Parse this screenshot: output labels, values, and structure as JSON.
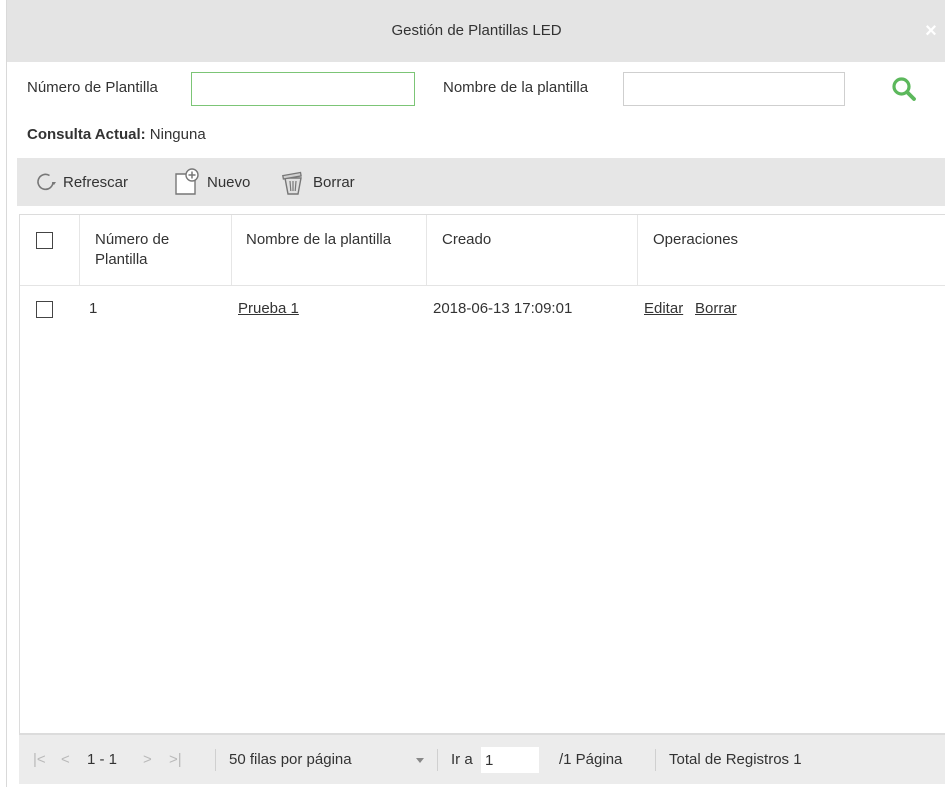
{
  "dialog": {
    "title": "Gestión de Plantillas LED",
    "close_glyph": "×"
  },
  "search": {
    "number_label": "Número de Plantilla",
    "number_value": "",
    "name_label": "Nombre de la plantilla",
    "name_value": "",
    "search_icon": "search-icon"
  },
  "query": {
    "label": "Consulta Actual:",
    "value": "Ninguna"
  },
  "toolbar": {
    "refresh_label": "Refrescar",
    "new_label": "Nuevo",
    "delete_label": "Borrar"
  },
  "table": {
    "headers": {
      "number": "Número de Plantilla",
      "name": "Nombre de la plantilla",
      "created": "Creado",
      "operations": "Operaciones"
    },
    "rows": [
      {
        "number": "1",
        "name": "Prueba 1",
        "created": "2018-06-13 17:09:01",
        "edit": "Editar",
        "delete": "Borrar"
      }
    ]
  },
  "pager": {
    "first": "|<",
    "prev": "<",
    "range": "1 - 1",
    "next": ">",
    "last": ">|",
    "rows_per_page": "50 filas por página",
    "goto_label": "Ir a",
    "goto_value": "1",
    "pages": "/1 Página",
    "total": "Total de Registros 1"
  },
  "colors": {
    "title_bar": "#e4e4e4",
    "search_icon": "#5cb85c",
    "active_input_border": "#7cc576"
  }
}
